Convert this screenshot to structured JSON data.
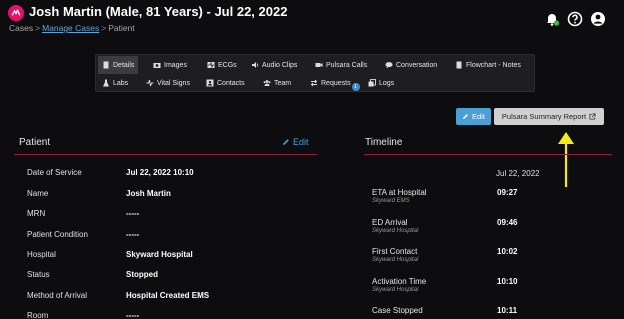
{
  "header": {
    "title": "Josh Martin (Male, 81 Years) - Jul 22, 2022",
    "breadcrumb": [
      "Cases",
      "Manage Cases",
      "Patient"
    ]
  },
  "tabs": {
    "row1": [
      "Details",
      "Images",
      "ECGs",
      "Audio Clips",
      "Pulsara Calls",
      "Conversation",
      "Flowchart - Notes"
    ],
    "row2": [
      "Labs",
      "Vital Signs",
      "Contacts",
      "Team",
      "Requests",
      "Logs"
    ],
    "requests_badge": "1"
  },
  "actions": {
    "edit_label": "Edit",
    "report_label": "Pulsara Summary Report"
  },
  "patient": {
    "title": "Patient",
    "edit_label": "Edit",
    "rows": [
      {
        "label": "Date of Service",
        "value": "Jul 22, 2022 10:10"
      },
      {
        "label": "Name",
        "value": "Josh Martin"
      },
      {
        "label": "MRN",
        "value": "-----"
      },
      {
        "label": "Patient Condition",
        "value": "-----"
      },
      {
        "label": "Hospital",
        "value": "Skyward Hospital"
      },
      {
        "label": "Status",
        "value": "Stopped"
      },
      {
        "label": "Method of Arrival",
        "value": "Hospital Created EMS"
      },
      {
        "label": "Room",
        "value": "-----"
      }
    ]
  },
  "timeline": {
    "title": "Timeline",
    "date": "Jul 22, 2022",
    "events": [
      {
        "label": "ETA at Hospital",
        "source": "Skyward EMS",
        "time": "09:27"
      },
      {
        "label": "ED Arrival",
        "source": "Skyward Hospital",
        "time": "09:46"
      },
      {
        "label": "First Contact",
        "source": "Skyward Hospital",
        "time": "10:02"
      },
      {
        "label": "Activation Time",
        "source": "Skyward Hospital",
        "time": "10:10"
      },
      {
        "label": "Case Stopped",
        "source": "",
        "time": "10:11"
      }
    ]
  },
  "colors": {
    "accent": "#4a9fd4",
    "brand": "#e8106b",
    "divider": "#8b2340",
    "annotation_arrow": "#f2ec1c"
  }
}
